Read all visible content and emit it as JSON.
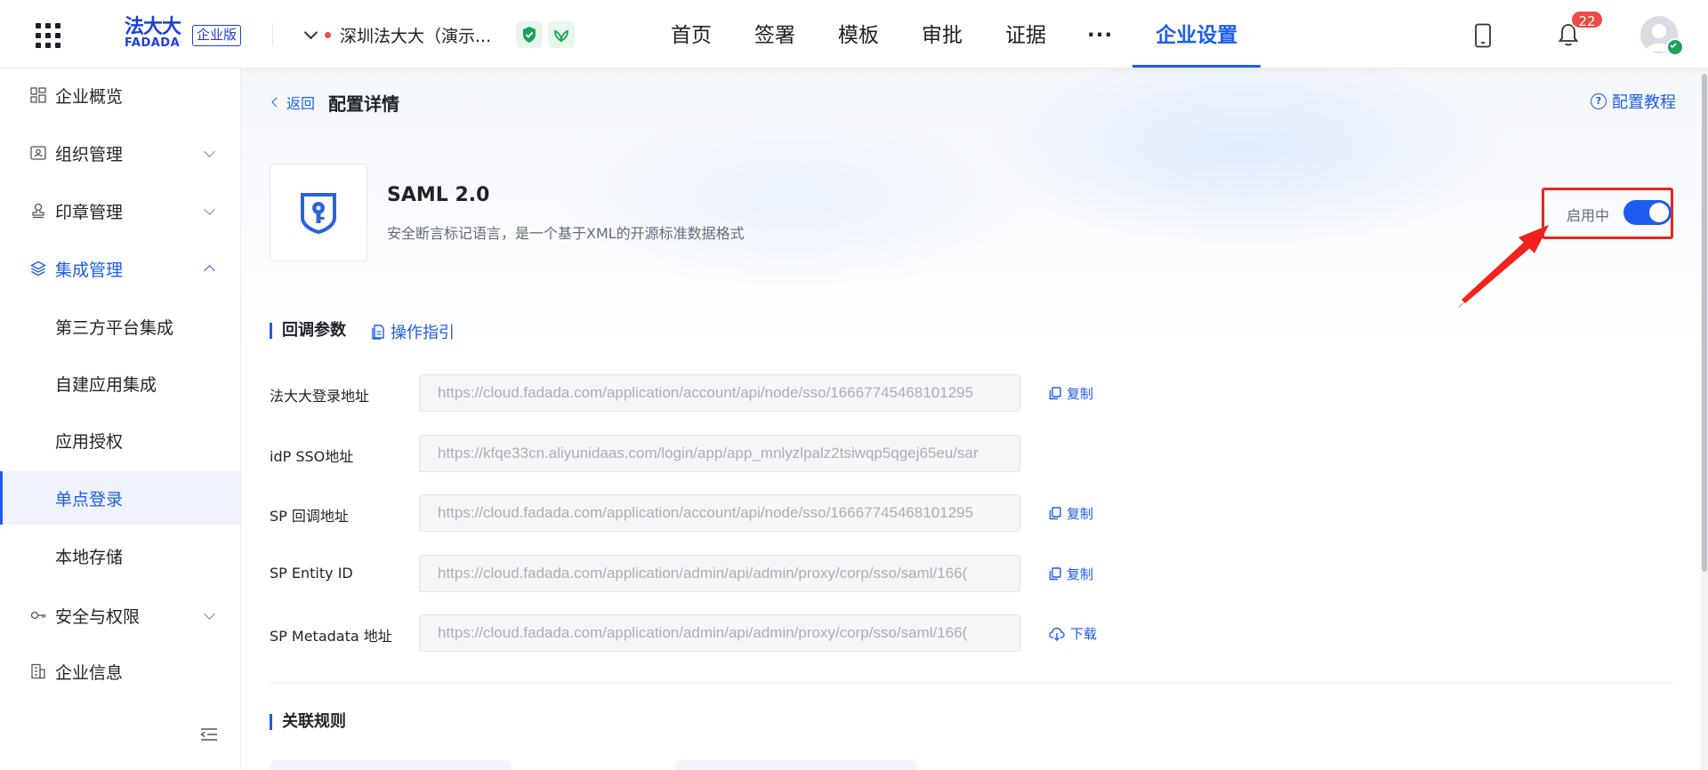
{
  "header": {
    "logo_cn": "法大大",
    "logo_en": "FADADA",
    "edition": "企业版",
    "company": "深圳法大大（演示...",
    "nav": [
      "首页",
      "签署",
      "模板",
      "审批",
      "证据"
    ],
    "nav_more": "···",
    "nav_active": "企业设置",
    "notification_count": "22"
  },
  "sidebar": {
    "items": [
      {
        "label": "企业概览",
        "icon": "dashboard-icon"
      },
      {
        "label": "组织管理",
        "icon": "organization-icon"
      },
      {
        "label": "印章管理",
        "icon": "seal-icon"
      },
      {
        "label": "集成管理",
        "icon": "layers-icon"
      },
      {
        "label": "第三方平台集成"
      },
      {
        "label": "自建应用集成"
      },
      {
        "label": "应用授权"
      },
      {
        "label": "单点登录"
      },
      {
        "label": "本地存储"
      },
      {
        "label": "安全与权限",
        "icon": "key-icon"
      },
      {
        "label": "企业信息",
        "icon": "building-icon"
      }
    ],
    "selected": "单点登录"
  },
  "page": {
    "back": "返回",
    "title": "配置详情",
    "tutorial": "配置教程"
  },
  "app": {
    "name": "SAML 2.0",
    "description": "安全断言标记语言，是一个基于XML的开源标准数据格式",
    "status": "启用中",
    "enabled": true
  },
  "callback": {
    "title": "回调参数",
    "guide": "操作指引",
    "fields": [
      {
        "label": "法大大登录地址",
        "value": "https://cloud.fadada.com/application/account/api/node/sso/16667745468101295",
        "action": "复制"
      },
      {
        "label": "idP SSO地址",
        "value": "https://kfqe33cn.aliyunidaas.com/login/app/app_mnlyzlpalz2tsiwqp5qgej65eu/sar",
        "action": ""
      },
      {
        "label": "SP 回调地址",
        "value": "https://cloud.fadada.com/application/account/api/node/sso/16667745468101295",
        "action": "复制"
      },
      {
        "label": "SP Entity ID",
        "value": "https://cloud.fadada.com/application/admin/api/admin/proxy/corp/sso/saml/166(",
        "action": "复制"
      },
      {
        "label": "SP Metadata 地址",
        "value": "https://cloud.fadada.com/application/admin/api/admin/proxy/corp/sso/saml/166(",
        "action": "下载"
      }
    ]
  },
  "rules": {
    "title": "关联规则"
  },
  "colors": {
    "primary": "#1d5cf0",
    "highlight": "#f2211c",
    "badge": "#f04848"
  }
}
